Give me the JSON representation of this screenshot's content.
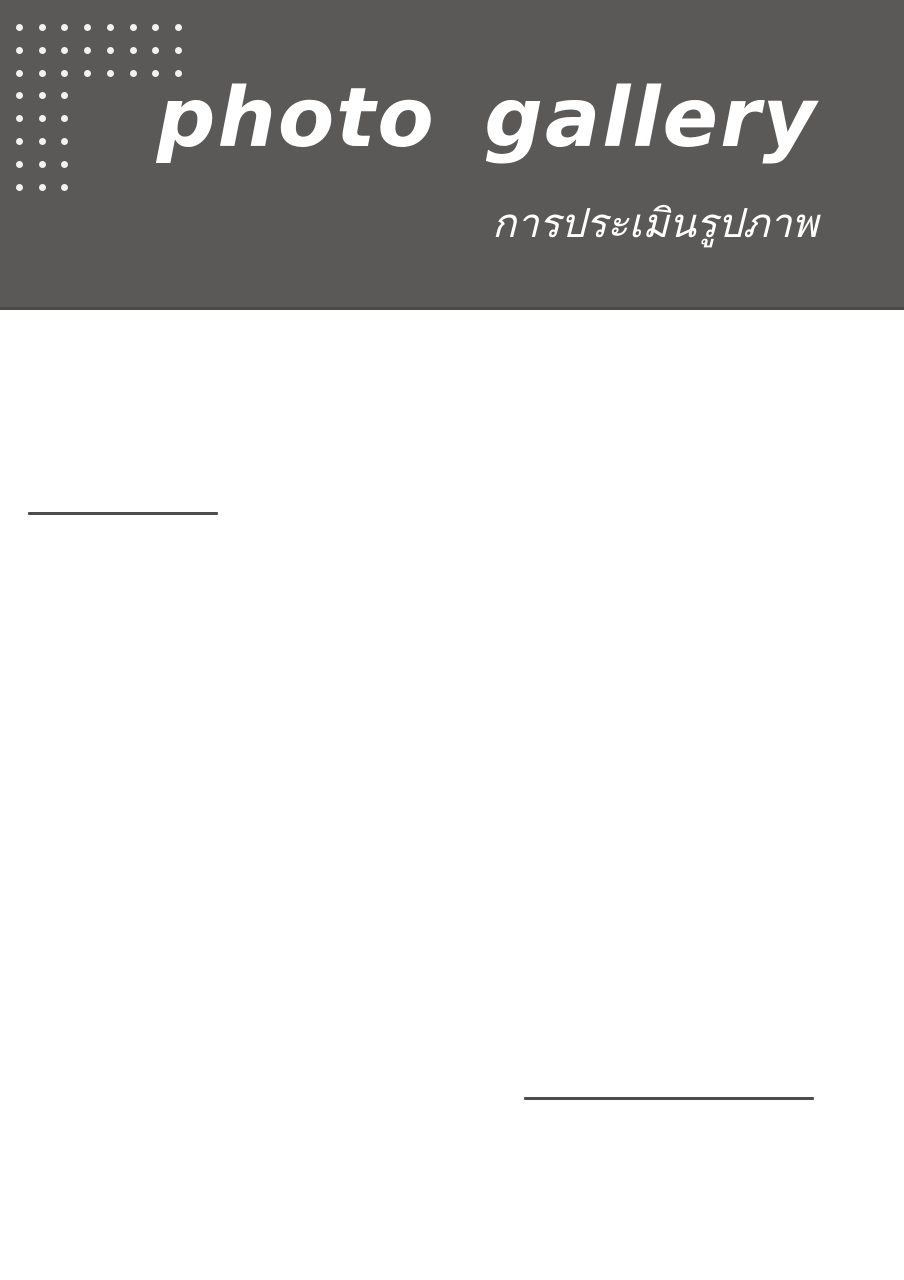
{
  "header": {
    "title": "photo  gallery",
    "subtitle": "การประเมินรูปภาพ",
    "background_color": "#5a5958",
    "text_color": "#ffffff",
    "decoration_icon": "dot-grid-icon"
  },
  "body": {
    "background_color": "#ffffff",
    "rule_color": "#4d4d4d"
  }
}
